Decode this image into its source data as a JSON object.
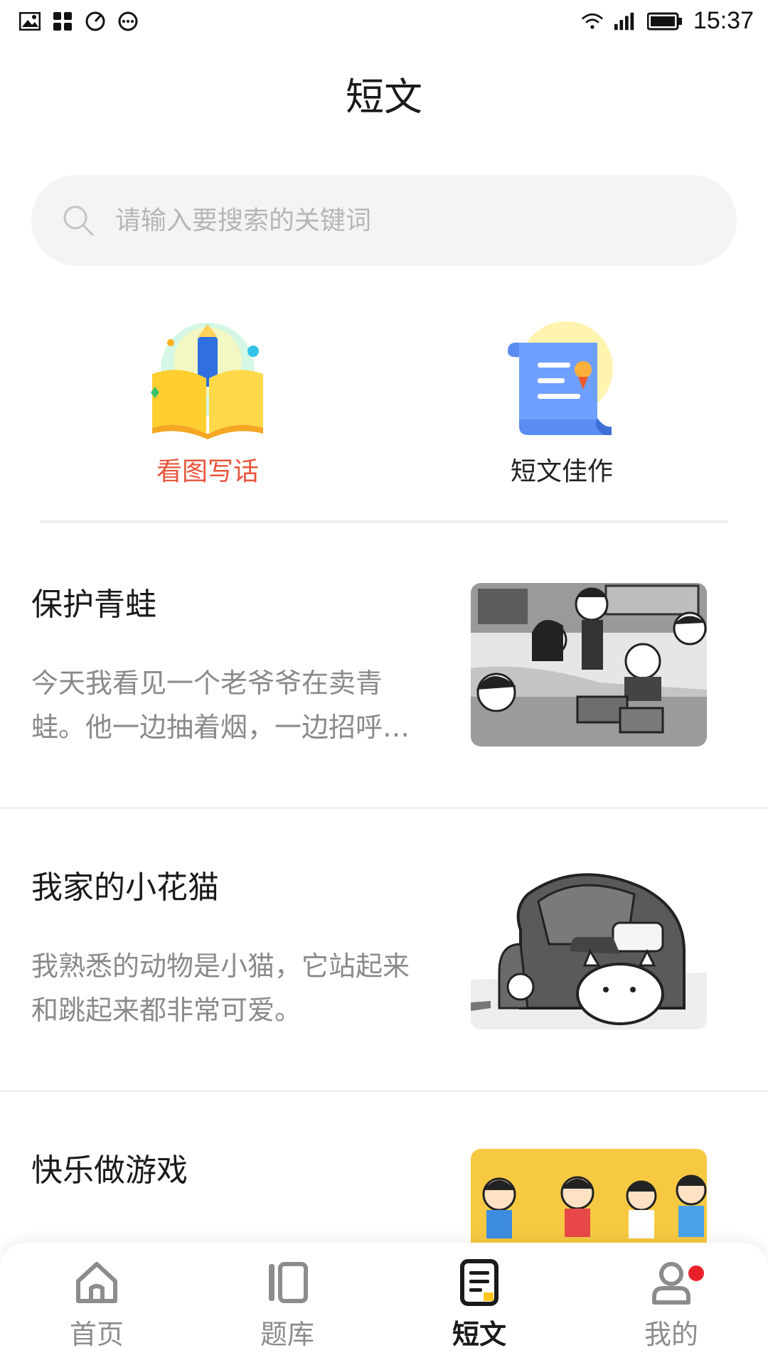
{
  "status_bar": {
    "time": "15:37",
    "icons": [
      "image-icon",
      "apps-icon",
      "speedometer-icon",
      "more-circle-icon",
      "wifi-icon",
      "signal-icon",
      "battery-icon"
    ]
  },
  "header": {
    "title": "短文"
  },
  "search": {
    "placeholder": "请输入要搜索的关键词"
  },
  "categories": [
    {
      "label": "看图写话",
      "icon": "open-book-icon",
      "color": "#e8553b"
    },
    {
      "label": "短文佳作",
      "icon": "scroll-certificate-icon",
      "color": "#222222"
    }
  ],
  "articles": [
    {
      "title": "保护青蛙",
      "excerpt": "今天我看见一个老爷爷在卖青蛙。他一边抽着烟，一边招呼…"
    },
    {
      "title": "我家的小花猫",
      "excerpt": "我熟悉的动物是小猫，它站起来和跳起来都非常可爱。"
    },
    {
      "title": "快乐做游戏",
      "excerpt": ""
    }
  ],
  "bottom_nav": {
    "items": [
      {
        "label": "首页",
        "icon": "home-icon"
      },
      {
        "label": "题库",
        "icon": "question-bank-icon"
      },
      {
        "label": "短文",
        "icon": "document-icon",
        "active": true
      },
      {
        "label": "我的",
        "icon": "user-icon",
        "badge": true
      }
    ]
  },
  "colors": {
    "accent": "#e8553b",
    "badge": "#e8202a",
    "search_bg": "#f4f4f4"
  }
}
